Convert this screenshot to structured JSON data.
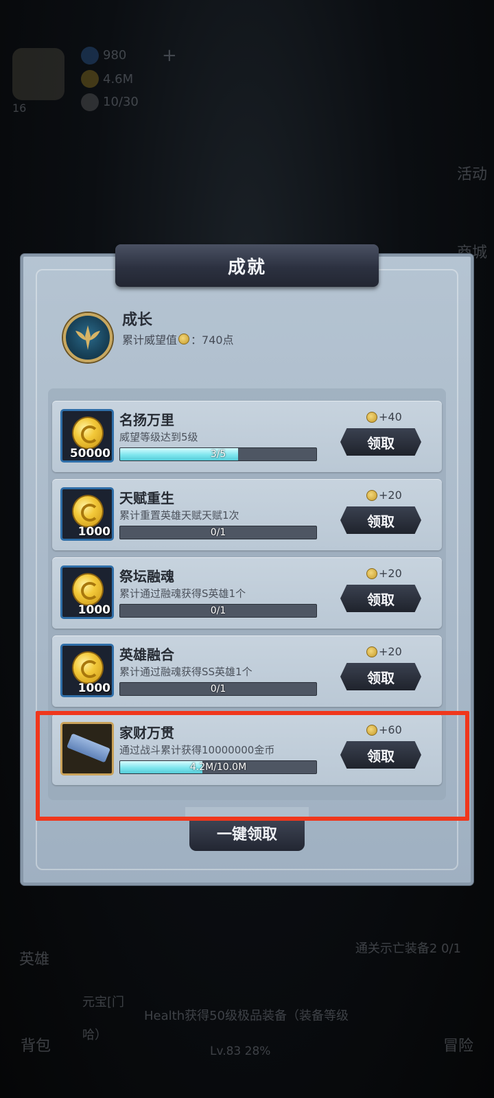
{
  "hud": {
    "gems": "980",
    "gold": "4.6M",
    "stamina": "10/30",
    "level": "16",
    "plus": "+"
  },
  "side": {
    "activity": "活动",
    "shop": "商城"
  },
  "bottom": {
    "hero": "英雄",
    "bag": "背包",
    "adventure": "冒险",
    "quest": "通关示亡装备2 0/1",
    "tip_line1": "元宝[门",
    "tip_line2": "Health获得50级极品装备（装备等级",
    "tip_line3": "哈）",
    "level_progress": "Lv.83 28%"
  },
  "panel": {
    "title": "成就",
    "category_title": "成长",
    "category_sub_prefix": "累计威望值",
    "category_sub_suffix": "：740点"
  },
  "achievements": [
    {
      "title": "名扬万里",
      "desc": "威望等级达到5级",
      "progress_text": "3/5",
      "progress": 0.6,
      "icon": "gold-coin",
      "icon_count": "50000",
      "reward": "+40",
      "button": "领取"
    },
    {
      "title": "天赋重生",
      "desc": "累计重置英雄天赋天赋1次",
      "progress_text": "0/1",
      "progress": 0,
      "icon": "gold-coin",
      "icon_count": "1000",
      "reward": "+20",
      "button": "领取"
    },
    {
      "title": "祭坛融魂",
      "desc": "累计通过融魂获得S英雄1个",
      "progress_text": "0/1",
      "progress": 0,
      "icon": "gold-coin",
      "icon_count": "1000",
      "reward": "+20",
      "button": "领取"
    },
    {
      "title": "英雄融合",
      "desc": "累计通过融魂获得SS英雄1个",
      "progress_text": "0/1",
      "progress": 0,
      "icon": "gold-coin",
      "icon_count": "1000",
      "reward": "+20",
      "button": "领取"
    },
    {
      "title": "家财万贯",
      "desc": "通过战斗累计获得10000000金币",
      "progress_text": "4.2M/10.0M",
      "progress": 0.42,
      "icon": "blue-scroll",
      "icon_count": "",
      "reward": "+60",
      "button": "领取"
    }
  ],
  "claim_all_label": "一键领取",
  "colors": {
    "highlight": "#f0371c",
    "progress_fill": "#7fe6ee",
    "panel": "#b5c4d2"
  }
}
